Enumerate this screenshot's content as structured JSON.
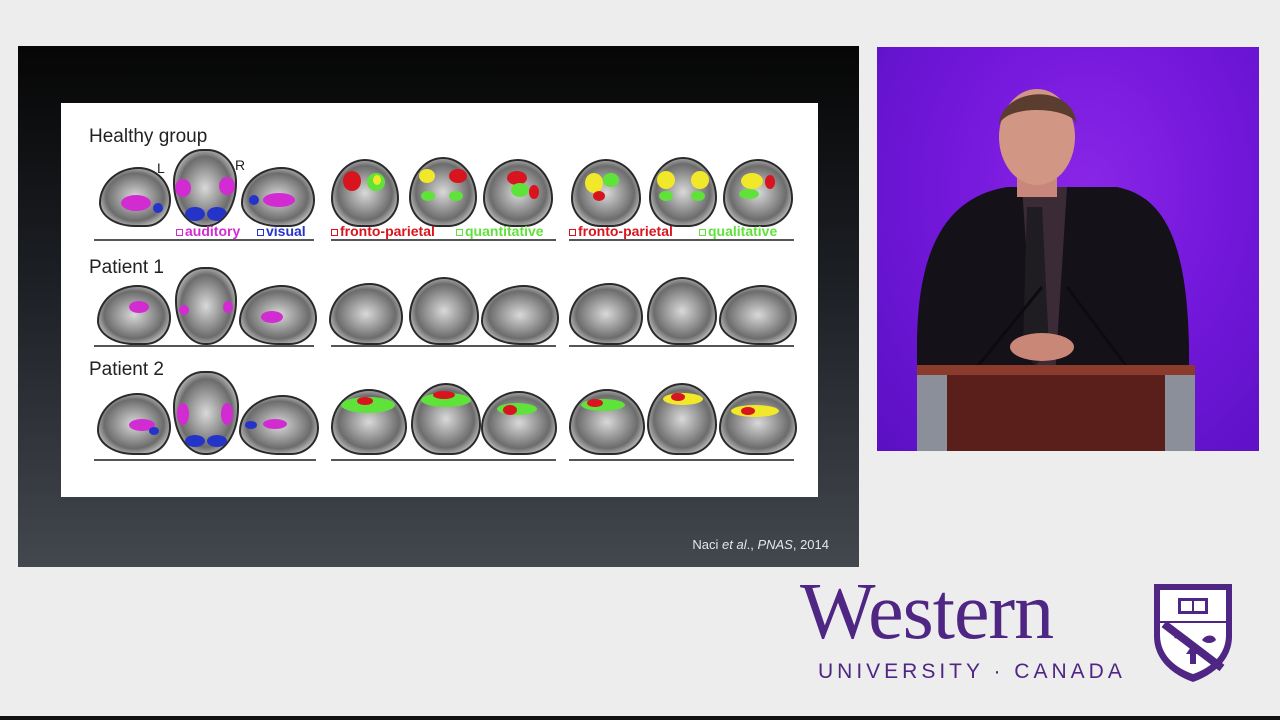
{
  "slide": {
    "rows": [
      {
        "label": "Healthy group"
      },
      {
        "label": "Patient 1"
      },
      {
        "label": "Patient 2"
      }
    ],
    "hemisphere_left": "L",
    "hemisphere_right": "R",
    "legend": {
      "auditory": "auditory",
      "visual": "visual",
      "fronto_parietal_1": "fronto-parietal",
      "quantitative": "quantitative",
      "fronto_parietal_2": "fronto-parietal",
      "qualitative": "qualitative"
    },
    "citation_prefix": "Naci ",
    "citation_etal": "et al",
    "citation_mid": "., ",
    "citation_journal": "PNAS",
    "citation_year": ", 2014"
  },
  "logo": {
    "wordmark": "Western",
    "tagline": "UNIVERSITY · CANADA"
  },
  "colors": {
    "auditory": "#d22bd2",
    "visual": "#2534c8",
    "fronto_parietal": "#d8141e",
    "quantitative": "#5fe23a",
    "brand_purple": "#4f2683"
  }
}
